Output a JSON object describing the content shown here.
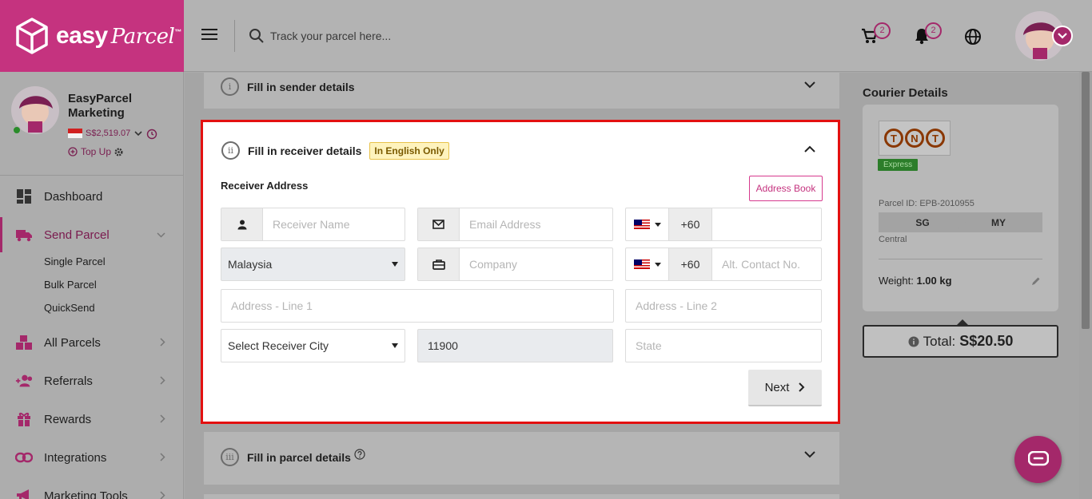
{
  "brand": {
    "name": "easy",
    "script": "Parcel",
    "tm": "™"
  },
  "search": {
    "placeholder": "Track your parcel here..."
  },
  "header": {
    "cart_count": "2",
    "notification_count": "2"
  },
  "profile": {
    "name": "EasyParcel Marketing",
    "balance": "S$2,519.07",
    "topup_label": "Top Up"
  },
  "sidebar": {
    "items": [
      {
        "label": "Dashboard"
      },
      {
        "label": "Send Parcel"
      },
      {
        "label": "All Parcels"
      },
      {
        "label": "Referrals"
      },
      {
        "label": "Rewards"
      },
      {
        "label": "Integrations"
      },
      {
        "label": "Marketing Tools"
      }
    ],
    "sub_items": [
      {
        "label": "Single Parcel"
      },
      {
        "label": "Bulk Parcel"
      },
      {
        "label": "QuickSend"
      }
    ]
  },
  "steps": {
    "sender": {
      "number": "i",
      "title": "Fill in sender details"
    },
    "receiver": {
      "number": "ii",
      "title": "Fill in receiver details",
      "tag": "In English Only"
    },
    "parcel": {
      "number": "iii",
      "title": "Fill in parcel details"
    }
  },
  "receiver_form": {
    "section_label": "Receiver Address",
    "address_book_label": "Address Book",
    "name_placeholder": "Receiver Name",
    "email_placeholder": "Email Address",
    "phone_code": "+60",
    "country": "Malaysia",
    "company_placeholder": "Company",
    "alt_phone_code": "+60",
    "alt_contact_placeholder": "Alt. Contact No.",
    "address1_placeholder": "Address - Line 1",
    "address2_placeholder": "Address - Line 2",
    "city": "Select Receiver City",
    "postcode": "11900",
    "state_placeholder": "State",
    "next_label": "Next"
  },
  "courier": {
    "title": "Courier Details",
    "logo_text": [
      "T",
      "N",
      "T"
    ],
    "service": "Express",
    "parcel_id": "Parcel ID: EPB-2010955",
    "from": "SG",
    "to": "MY",
    "region": "Central",
    "weight_label": "Weight:",
    "weight_value": "1.00 kg",
    "total_label": "Total:",
    "total_value": "S$20.50"
  },
  "colors": {
    "brand": "#c5337f",
    "brand_dark": "#a4286a",
    "highlight": "#e31010",
    "english_tag_bg": "#fef3bd",
    "express_green": "#2c7d2a"
  }
}
